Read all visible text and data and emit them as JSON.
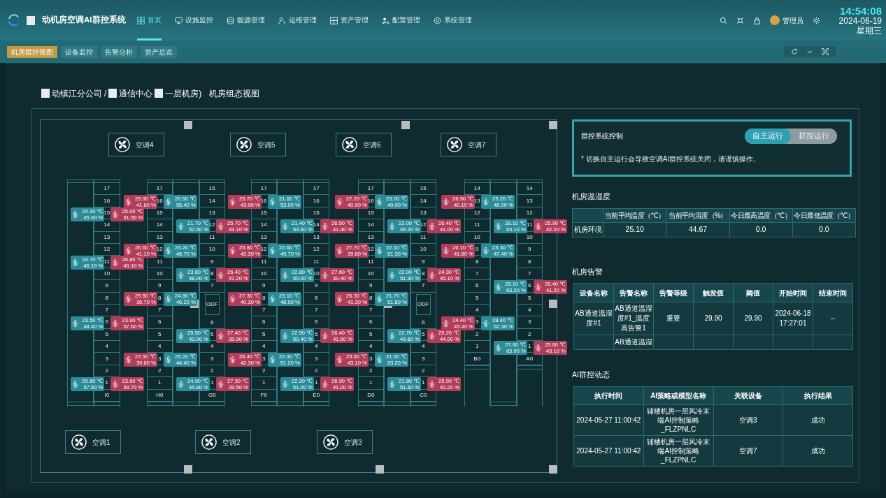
{
  "header": {
    "title": "动机房空调AI群控系统",
    "nav": [
      {
        "label": "首页",
        "selected": true
      },
      {
        "label": "设施监控",
        "selected": false
      },
      {
        "label": "能源管理",
        "selected": false
      },
      {
        "label": "运维管理",
        "selected": false
      },
      {
        "label": "资产管理",
        "selected": false
      },
      {
        "label": "配置管理",
        "selected": false
      },
      {
        "label": "系统管理",
        "selected": false
      }
    ],
    "user": "管理员",
    "clock": {
      "time": "14:54:08",
      "date": "2024-06-19",
      "weekday": "星期三"
    }
  },
  "subtabs": [
    {
      "label": "机房群控视图",
      "selected": true
    },
    {
      "label": "设备监控",
      "selected": false
    },
    {
      "label": "告警分析",
      "selected": false
    },
    {
      "label": "资产总览",
      "selected": false
    }
  ],
  "breadcrumb": [
    {
      "kind": "redacted"
    },
    {
      "kind": "text",
      "text": "动镇江分公司"
    },
    {
      "kind": "text",
      "text": "/"
    },
    {
      "kind": "redacted"
    },
    {
      "kind": "text",
      "text": "通信中心"
    },
    {
      "kind": "redacted"
    },
    {
      "kind": "text",
      "text": "一层机房)"
    },
    {
      "kind": "title",
      "text": "机房组态视图"
    }
  ],
  "floor_plan": {
    "ac_units_top": [
      {
        "label": "空调4"
      },
      {
        "label": "空调5"
      },
      {
        "label": "空调6"
      },
      {
        "label": "空调7"
      }
    ],
    "rack_groups": [
      {
        "racks": [
          {
            "kind": "empty"
          },
          {
            "kind": "cabinet",
            "units": [
              {
                "label": "17"
              },
              {
                "label": "16"
              },
              {
                "label": "15",
                "sensors": [
                  {
                    "temp": "24.90 ℃",
                    "humidity": "45.60 %",
                    "color": "#2b8c98"
                  },
                  {
                    "temp": "25.00 ℃",
                    "humidity": "51.50 %",
                    "color": "#b23d5a"
                  }
                ]
              },
              {
                "label": "14"
              },
              {
                "label": "13"
              },
              {
                "label": "12"
              },
              {
                "label": "11",
                "sensors": [
                  {
                    "temp": "24.70 ℃",
                    "humidity": "46.10 %",
                    "color": "#2b8c98"
                  },
                  {
                    "temp": "26.80 ℃",
                    "humidity": "49.10 %",
                    "color": "#b23d5a"
                  }
                ]
              },
              {
                "label": "10"
              },
              {
                "label": "9"
              },
              {
                "label": "8"
              },
              {
                "label": "7"
              },
              {
                "label": "6",
                "sensors": [
                  {
                    "temp": "23.50 ℃",
                    "humidity": "48.40 %",
                    "color": "#2b8c98"
                  },
                  {
                    "temp": "23.90 ℃",
                    "humidity": "57.60 %",
                    "color": "#b23d5a"
                  }
                ]
              },
              {
                "label": "5"
              },
              {
                "label": "4"
              },
              {
                "label": "3"
              },
              {
                "label": "2"
              },
              {
                "label": "1",
                "sensors": [
                  {
                    "temp": "20.80 ℃",
                    "humidity": "57.60 %",
                    "color": "#2b8c98"
                  },
                  {
                    "temp": "23.60 ℃",
                    "humidity": "59.70 %",
                    "color": "#b23d5a"
                  }
                ]
              },
              {
                "label": "I0"
              }
            ]
          }
        ]
      },
      {
        "racks": [
          {
            "kind": "cabinet",
            "units": [
              {
                "label": "17"
              },
              {
                "label": "16",
                "sensors": [
                  {
                    "temp": "25.90 ℃",
                    "humidity": "41.60 %",
                    "color": "#b23d5a"
                  },
                  {
                    "temp": "20.90 ℃",
                    "humidity": "55.40 %",
                    "color": "#2b8c98"
                  }
                ]
              },
              {
                "label": "15"
              },
              {
                "label": "14"
              },
              {
                "label": "13"
              },
              {
                "label": "12",
                "sensors": [
                  {
                    "temp": "26.60 ℃",
                    "humidity": "41.10 %",
                    "color": "#b23d5a"
                  },
                  {
                    "temp": "23.20 ℃",
                    "humidity": "48.70 %",
                    "color": "#2b8c98"
                  }
                ]
              },
              {
                "label": "11"
              },
              {
                "label": "10"
              },
              {
                "label": "9"
              },
              {
                "label": "8",
                "sensors": [
                  {
                    "temp": "29.50 ℃",
                    "humidity": "36.70 %",
                    "color": "#b23d5a"
                  },
                  {
                    "temp": "24.80 ℃",
                    "humidity": "46.20 %",
                    "color": "#2b8c98"
                  }
                ]
              },
              {
                "label": "7"
              },
              {
                "label": "6"
              },
              {
                "label": "5"
              },
              {
                "label": "4"
              },
              {
                "label": "3",
                "sensors": [
                  {
                    "temp": "27.50 ℃",
                    "humidity": "39.60 %",
                    "color": "#b23d5a"
                  },
                  {
                    "temp": "25.20 ℃",
                    "humidity": "44.40 %",
                    "color": "#2b8c98"
                  }
                ]
              },
              {
                "label": "2"
              },
              {
                "label": "1"
              },
              {
                "label": "H0"
              }
            ]
          },
          {
            "kind": "empty"
          },
          {
            "kind": "split_cabinet",
            "upper_units": [
              {
                "label": "15"
              },
              {
                "label": "14"
              },
              {
                "label": "13"
              },
              {
                "label": "12",
                "sensors": [
                  {
                    "temp": "21.70 ℃",
                    "humidity": "52.50 %",
                    "color": "#2b8c98"
                  },
                  {
                    "temp": "25.70 ℃",
                    "humidity": "43.10 %",
                    "color": "#b23d5a"
                  }
                ]
              },
              {
                "label": "11"
              },
              {
                "label": "10"
              },
              {
                "label": "9"
              },
              {
                "label": "8",
                "sensors": [
                  {
                    "temp": "23.80 ℃",
                    "humidity": "48.00 %",
                    "color": "#2b8c98"
                  },
                  {
                    "temp": "26.40 ℃",
                    "humidity": "41.20 %",
                    "color": "#b23d5a"
                  }
                ]
              },
              {
                "label": "7"
              }
            ],
            "odf": "ODF",
            "lower_units": [
              {
                "label": "6"
              },
              {
                "label": "5",
                "sensors": [
                  {
                    "temp": "25.50 ℃",
                    "humidity": "43.90 %",
                    "color": "#2b8c98"
                  },
                  {
                    "temp": "27.40 ℃",
                    "humidity": "39.90 %",
                    "color": "#b23d5a"
                  }
                ]
              },
              {
                "label": "4"
              },
              {
                "label": "3"
              },
              {
                "label": "2"
              },
              {
                "label": "1",
                "sensors": [
                  {
                    "temp": "24.90 ℃",
                    "humidity": "44.80 %",
                    "color": "#2b8c98"
                  },
                  {
                    "temp": "27.50 ℃",
                    "humidity": "39.50 %",
                    "color": "#b23d5a"
                  }
                ]
              },
              {
                "label": "G0"
              }
            ]
          }
        ]
      },
      {
        "racks": [
          {
            "kind": "cabinet",
            "units": [
              {
                "label": "17"
              },
              {
                "label": "16",
                "sensors": [
                  {
                    "temp": "25.70 ℃",
                    "humidity": "43.00 %",
                    "color": "#b23d5a"
                  },
                  {
                    "temp": "21.60 ℃",
                    "humidity": "53.00 %",
                    "color": "#2b8c98"
                  }
                ]
              },
              {
                "label": "15"
              },
              {
                "label": "14"
              },
              {
                "label": "13"
              },
              {
                "label": "12",
                "sensors": [
                  {
                    "temp": "25.80 ℃",
                    "humidity": "42.30 %",
                    "color": "#b23d5a"
                  },
                  {
                    "temp": "22.60 ℃",
                    "humidity": "49.70 %",
                    "color": "#2b8c98"
                  }
                ]
              },
              {
                "label": "11"
              },
              {
                "label": "10"
              },
              {
                "label": "9"
              },
              {
                "label": "8",
                "sensors": [
                  {
                    "temp": "27.30 ℃",
                    "humidity": "40.30 %",
                    "color": "#b23d5a"
                  },
                  {
                    "temp": "23.10 ℃",
                    "humidity": "48.90 %",
                    "color": "#2b8c98"
                  }
                ]
              },
              {
                "label": "7"
              },
              {
                "label": "6"
              },
              {
                "label": "5"
              },
              {
                "label": "4"
              },
              {
                "label": "3",
                "sensors": [
                  {
                    "temp": "26.40 ℃",
                    "humidity": "42.30 %",
                    "color": "#b23d5a"
                  },
                  {
                    "temp": "22.30 ℃",
                    "humidity": "51.20 %",
                    "color": "#2b8c98"
                  }
                ]
              },
              {
                "label": "2"
              },
              {
                "label": "1"
              },
              {
                "label": "F0"
              }
            ]
          },
          {
            "kind": "empty"
          },
          {
            "kind": "cabinet",
            "units": [
              {
                "label": "17"
              },
              {
                "label": "16"
              },
              {
                "label": "15"
              },
              {
                "label": "14",
                "sensors": [
                  {
                    "temp": "21.40 ℃",
                    "humidity": "53.60 %",
                    "color": "#2b8c98"
                  },
                  {
                    "temp": "26.50 ℃",
                    "humidity": "41.40 %",
                    "color": "#b23d5a"
                  }
                ]
              },
              {
                "label": "13"
              },
              {
                "label": "12"
              },
              {
                "label": "11"
              },
              {
                "label": "10",
                "sensors": [
                  {
                    "temp": "22.80 ℃",
                    "humidity": "50.00 %",
                    "color": "#2b8c98"
                  },
                  {
                    "temp": "27.60 ℃",
                    "humidity": "39.40 %",
                    "color": "#b23d5a"
                  }
                ]
              },
              {
                "label": "9"
              },
              {
                "label": "8"
              },
              {
                "label": "7"
              },
              {
                "label": "6"
              },
              {
                "label": "5",
                "sensors": [
                  {
                    "temp": "22.50 ℃",
                    "humidity": "50.40 %",
                    "color": "#2b8c98"
                  },
                  {
                    "temp": "26.40 ℃",
                    "humidity": "41.60 %",
                    "color": "#b23d5a"
                  }
                ]
              },
              {
                "label": "4"
              },
              {
                "label": "3"
              },
              {
                "label": "2"
              },
              {
                "label": "1",
                "sensors": [
                  {
                    "temp": "22.20 ℃",
                    "humidity": "51.00 %",
                    "color": "#2b8c98"
                  },
                  {
                    "temp": "26.90 ℃",
                    "humidity": "41.00 %",
                    "color": "#b23d5a"
                  }
                ]
              },
              {
                "label": "E0"
              }
            ]
          }
        ]
      },
      {
        "racks": [
          {
            "kind": "cabinet",
            "units": [
              {
                "label": "17"
              },
              {
                "label": "16",
                "sensors": [
                  {
                    "temp": "27.20 ℃",
                    "humidity": "40.90 %",
                    "color": "#b23d5a"
                  },
                  {
                    "temp": "23.00 ℃",
                    "humidity": "49.00 %",
                    "color": "#2b8c98"
                  }
                ]
              },
              {
                "label": "15"
              },
              {
                "label": "14"
              },
              {
                "label": "13"
              },
              {
                "label": "12",
                "sensors": [
                  {
                    "temp": "27.70 ℃",
                    "humidity": "39.80 %",
                    "color": "#b23d5a"
                  },
                  {
                    "temp": "22.10 ℃",
                    "humidity": "51.30 %",
                    "color": "#2b8c98"
                  }
                ]
              },
              {
                "label": "11"
              },
              {
                "label": "10"
              },
              {
                "label": "9"
              },
              {
                "label": "8",
                "sensors": [
                  {
                    "temp": "26.30 ℃",
                    "humidity": "41.30 %",
                    "color": "#b23d5a"
                  },
                  {
                    "temp": "21.70 ℃",
                    "humidity": "51.80 %",
                    "color": "#2b8c98"
                  }
                ]
              },
              {
                "label": "7"
              },
              {
                "label": "6"
              },
              {
                "label": "5"
              },
              {
                "label": "4"
              },
              {
                "label": "3",
                "sensors": [
                  {
                    "temp": "25.60 ℃",
                    "humidity": "43.10 %",
                    "color": "#b23d5a"
                  },
                  {
                    "temp": "21.50 ℃",
                    "humidity": "53.20 %",
                    "color": "#2b8c98"
                  }
                ]
              },
              {
                "label": "2"
              },
              {
                "label": "1"
              },
              {
                "label": "D0"
              }
            ]
          },
          {
            "kind": "empty"
          },
          {
            "kind": "split_cabinet",
            "upper_units": [
              {
                "label": "15"
              },
              {
                "label": "14"
              },
              {
                "label": "13"
              },
              {
                "label": "12",
                "sensors": [
                  {
                    "temp": "23.00 ℃",
                    "humidity": "49.20 %",
                    "color": "#2b8c98"
                  },
                  {
                    "temp": "26.40 ℃",
                    "humidity": "41.00 %",
                    "color": "#b23d5a"
                  }
                ]
              },
              {
                "label": "11"
              },
              {
                "label": "10"
              },
              {
                "label": "9"
              },
              {
                "label": "8",
                "sensors": [
                  {
                    "temp": "22.00 ℃",
                    "humidity": "51.90 %",
                    "color": "#2b8c98"
                  },
                  {
                    "temp": "24.30 ℃",
                    "humidity": "45.10 %",
                    "color": "#b23d5a"
                  }
                ]
              },
              {
                "label": "7"
              }
            ],
            "odf": "ODF",
            "lower_units": [
              {
                "label": "6"
              },
              {
                "label": "5",
                "sensors": [
                  {
                    "temp": "22.70 ℃",
                    "humidity": "49.60 %",
                    "color": "#2b8c98"
                  },
                  {
                    "temp": "25.20 ℃",
                    "humidity": "44.00 %",
                    "color": "#b23d5a"
                  }
                ]
              },
              {
                "label": "4"
              },
              {
                "label": "3"
              },
              {
                "label": "2"
              },
              {
                "label": "1",
                "sensors": [
                  {
                    "temp": "21.80 ℃",
                    "humidity": "51.60 %",
                    "color": "#2b8c98"
                  },
                  {
                    "temp": "25.90 ℃",
                    "humidity": "42.20 %",
                    "color": "#b23d5a"
                  }
                ]
              },
              {
                "label": "C0"
              }
            ]
          }
        ]
      },
      {
        "racks": [
          {
            "kind": "cabinet",
            "units": [
              {
                "label": "14"
              },
              {
                "label": "13",
                "sensors": [
                  {
                    "temp": "26.90 ℃",
                    "humidity": "40.10 %",
                    "color": "#b23d5a"
                  },
                  {
                    "temp": "23.20 ℃",
                    "humidity": "48.00 %",
                    "color": "#2b8c98"
                  }
                ]
              },
              {
                "label": "12"
              },
              {
                "label": "11"
              },
              {
                "label": "10"
              },
              {
                "label": "9",
                "sensors": [
                  {
                    "temp": "26.10 ℃",
                    "humidity": "41.80 %",
                    "color": "#b23d5a"
                  },
                  {
                    "temp": "23.30 ℃",
                    "humidity": "47.40 %",
                    "color": "#2b8c98"
                  }
                ]
              },
              {
                "label": "8"
              },
              {
                "label": "7"
              },
              {
                "label": "6"
              },
              {
                "label": "5"
              },
              {
                "label": "4"
              },
              {
                "label": "3",
                "sensors": [
                  {
                    "temp": "24.40 ℃",
                    "humidity": "45.40 %",
                    "color": "#b23d5a"
                  },
                  {
                    "temp": "28.40 ℃",
                    "humidity": "62.30 %",
                    "color": "#2b8c98"
                  }
                ]
              },
              {
                "label": "2"
              },
              {
                "label": "1"
              },
              {
                "label": "B0"
              }
            ]
          },
          {
            "kind": "empty"
          },
          {
            "kind": "cabinet",
            "units": [
              {
                "label": "14"
              },
              {
                "label": "13"
              },
              {
                "label": "12"
              },
              {
                "label": "11",
                "sensors": [
                  {
                    "temp": "28.10 ℃",
                    "humidity": "63.10 %",
                    "color": "#2b8c98"
                  },
                  {
                    "temp": "25.90 ℃",
                    "humidity": "42.20 %",
                    "color": "#b23d5a"
                  }
                ]
              },
              {
                "label": "10"
              },
              {
                "label": "9"
              },
              {
                "label": "8"
              },
              {
                "label": "7"
              },
              {
                "label": "6",
                "sensors": [
                  {
                    "temp": "28.10 ℃",
                    "humidity": "63.20 %",
                    "color": "#2b8c98"
                  },
                  {
                    "temp": "26.40 ℃",
                    "humidity": "41.20 %",
                    "color": "#b23d5a"
                  }
                ]
              },
              {
                "label": "5"
              },
              {
                "label": "4"
              },
              {
                "label": "3"
              },
              {
                "label": "2"
              },
              {
                "label": "1",
                "sensors": [
                  {
                    "temp": "27.90 ℃",
                    "humidity": "63.90 %",
                    "color": "#2b8c98"
                  },
                  {
                    "temp": "25.60 ℃",
                    "humidity": "43.10 %",
                    "color": "#b23d5a"
                  }
                ]
              },
              {
                "label": "A0"
              }
            ]
          }
        ]
      }
    ],
    "ac_units_bottom": [
      {
        "label": "空调1"
      },
      {
        "label": "空调2"
      },
      {
        "label": "空调3"
      }
    ]
  },
  "control": {
    "title": "群控系统控制",
    "modes": [
      {
        "label": "自主运行",
        "selected": true
      },
      {
        "label": "群控运行",
        "selected": false
      }
    ],
    "note": "* 切换自主运行会导致空调AI群控系统关闭，请谨慎操作。"
  },
  "climate": {
    "title": "机房温湿度",
    "columns": [
      "当前平均温度（℃）",
      "当前平均湿度（%）",
      "今日最高温度（℃）",
      "今日最低温度（℃）"
    ],
    "row": {
      "label": "机房环境",
      "values": [
        "25.10",
        "44.67",
        "0.0",
        "0.0"
      ]
    }
  },
  "alarms": {
    "title": "机房告警",
    "columns": [
      "设备名称",
      "告警名称",
      "告警等级",
      "触发值",
      "阈值",
      "开始时间",
      "结束时间"
    ],
    "rows": [
      {
        "device": "AB通道温湿度#1",
        "alarm": "AB通道温湿度#1_温度高告警1",
        "level": "重要",
        "trigger": "29.90",
        "threshold": "29.90",
        "start": "2024-06-18 17:27:01",
        "end": "--"
      },
      {
        "alarm": "AB通道温湿"
      }
    ]
  },
  "ai_log": {
    "title": "AI群控动态",
    "columns": [
      "执行时间",
      "AI策略或模型名称",
      "关联设备",
      "执行结果"
    ],
    "rows": [
      {
        "time": "2024-05-27 11:00:42",
        "strategy": "辅楼机房一层风冷末端AI控制策略_FLZPNLC",
        "device": "空调3",
        "result": "成功"
      },
      {
        "time": "2024-05-27 11:00:42",
        "strategy": "辅楼机房一层风冷末端AI控制策略_FLZPNLC",
        "device": "空调7",
        "result": "成功"
      }
    ]
  }
}
